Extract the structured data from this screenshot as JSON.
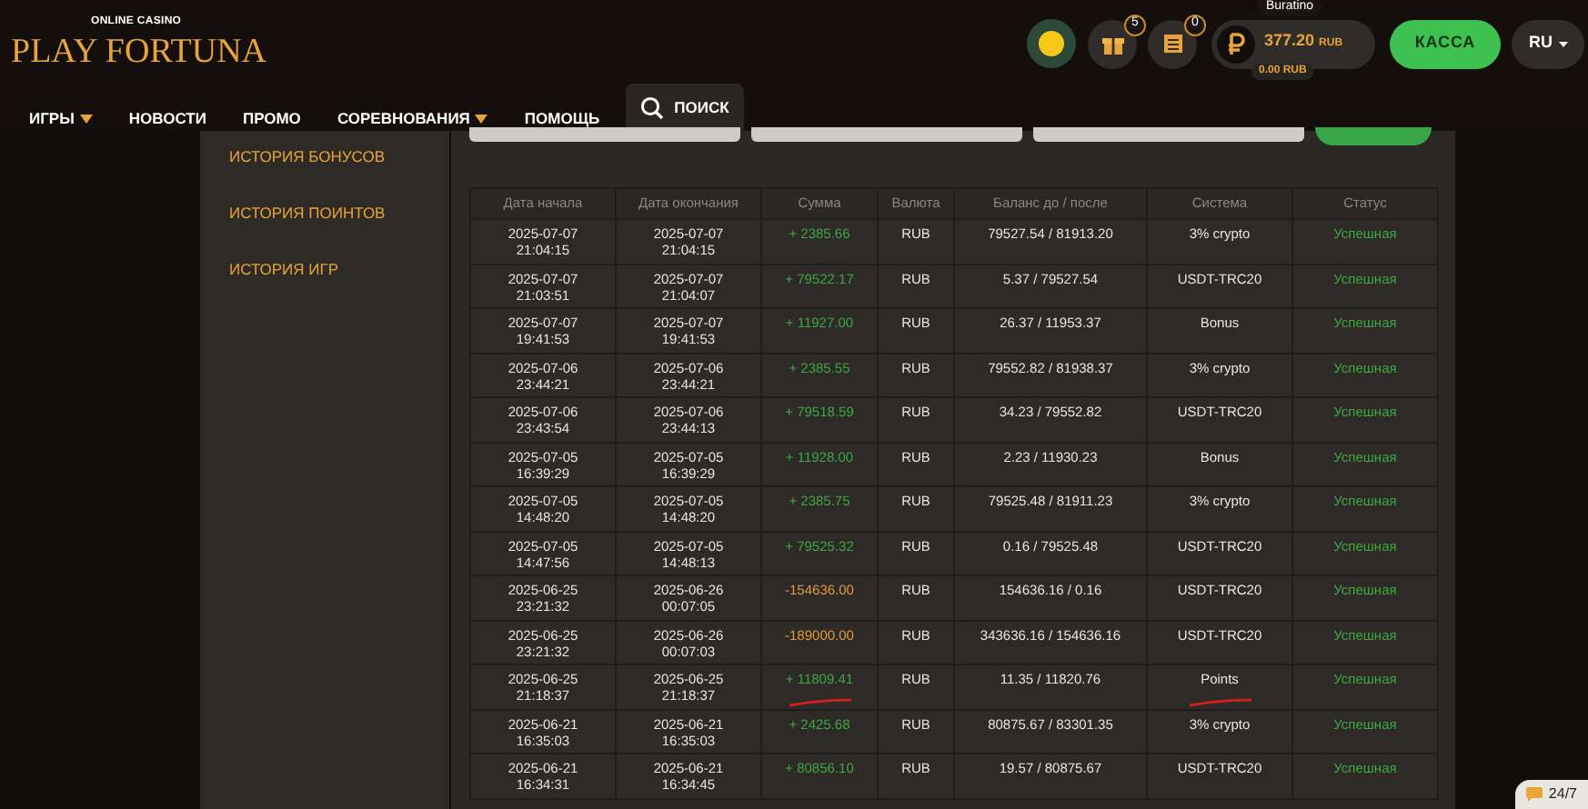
{
  "logo": {
    "tagline": "ONLINE CASINO",
    "name": "PLAY FORTUNA"
  },
  "nav": [
    {
      "label": "ИГРЫ",
      "dropdown": true
    },
    {
      "label": "НОВОСТИ",
      "dropdown": false
    },
    {
      "label": "ПРОМО",
      "dropdown": false
    },
    {
      "label": "СОРЕВНОВАНИЯ",
      "dropdown": true
    },
    {
      "label": "ПОМОЩЬ",
      "dropdown": false
    }
  ],
  "search": {
    "label": "ПОИСК"
  },
  "account": {
    "gifts_count": "5",
    "tasks_count": "0",
    "username": "Buratino",
    "balance": "377.20",
    "currency": "RUB",
    "bonus_balance": "0.00 RUB"
  },
  "cashier_button": "КАССА",
  "language": "RU",
  "sidebar": {
    "items": [
      {
        "label": "ИСТОРИЯ БОНУСОВ"
      },
      {
        "label": "ИСТОРИЯ ПОИНТОВ"
      },
      {
        "label": "ИСТОРИЯ ИГР"
      }
    ]
  },
  "table": {
    "columns": [
      "Дата начала",
      "Дата окончания",
      "Сумма",
      "Валюта",
      "Баланс до / после",
      "Система",
      "Статус"
    ],
    "rows": [
      {
        "start": [
          "2025-07-07",
          "21:04:15"
        ],
        "end": [
          "2025-07-07",
          "21:04:15"
        ],
        "sum": "+ 2385.66",
        "kind": "credit",
        "currency": "RUB",
        "balance": "79527.54 / 81913.20",
        "system": "3% crypto",
        "status": "Успешная",
        "underlined": false
      },
      {
        "start": [
          "2025-07-07",
          "21:03:51"
        ],
        "end": [
          "2025-07-07",
          "21:04:07"
        ],
        "sum": "+ 79522.17",
        "kind": "credit",
        "currency": "RUB",
        "balance": "5.37 / 79527.54",
        "system": "USDT-TRC20",
        "status": "Успешная",
        "underlined": false
      },
      {
        "start": [
          "2025-07-07",
          "19:41:53"
        ],
        "end": [
          "2025-07-07",
          "19:41:53"
        ],
        "sum": "+ 11927.00",
        "kind": "credit",
        "currency": "RUB",
        "balance": "26.37 / 11953.37",
        "system": "Bonus",
        "status": "Успешная",
        "underlined": false
      },
      {
        "start": [
          "2025-07-06",
          "23:44:21"
        ],
        "end": [
          "2025-07-06",
          "23:44:21"
        ],
        "sum": "+ 2385.55",
        "kind": "credit",
        "currency": "RUB",
        "balance": "79552.82 / 81938.37",
        "system": "3% crypto",
        "status": "Успешная",
        "underlined": false
      },
      {
        "start": [
          "2025-07-06",
          "23:43:54"
        ],
        "end": [
          "2025-07-06",
          "23:44:13"
        ],
        "sum": "+ 79518.59",
        "kind": "credit",
        "currency": "RUB",
        "balance": "34.23 / 79552.82",
        "system": "USDT-TRC20",
        "status": "Успешная",
        "underlined": false
      },
      {
        "start": [
          "2025-07-05",
          "16:39:29"
        ],
        "end": [
          "2025-07-05",
          "16:39:29"
        ],
        "sum": "+ 11928.00",
        "kind": "credit",
        "currency": "RUB",
        "balance": "2.23 / 11930.23",
        "system": "Bonus",
        "status": "Успешная",
        "underlined": false
      },
      {
        "start": [
          "2025-07-05",
          "14:48:20"
        ],
        "end": [
          "2025-07-05",
          "14:48:20"
        ],
        "sum": "+ 2385.75",
        "kind": "credit",
        "currency": "RUB",
        "balance": "79525.48 / 81911.23",
        "system": "3% crypto",
        "status": "Успешная",
        "underlined": false
      },
      {
        "start": [
          "2025-07-05",
          "14:47:56"
        ],
        "end": [
          "2025-07-05",
          "14:48:13"
        ],
        "sum": "+ 79525.32",
        "kind": "credit",
        "currency": "RUB",
        "balance": "0.16 / 79525.48",
        "system": "USDT-TRC20",
        "status": "Успешная",
        "underlined": false
      },
      {
        "start": [
          "2025-06-25",
          "23:21:32"
        ],
        "end": [
          "2025-06-26",
          "00:07:05"
        ],
        "sum": "-154636.00",
        "kind": "debit",
        "currency": "RUB",
        "balance": "154636.16 / 0.16",
        "system": "USDT-TRC20",
        "status": "Успешная",
        "underlined": false
      },
      {
        "start": [
          "2025-06-25",
          "23:21:32"
        ],
        "end": [
          "2025-06-26",
          "00:07:03"
        ],
        "sum": "-189000.00",
        "kind": "debit",
        "currency": "RUB",
        "balance": "343636.16 / 154636.16",
        "system": "USDT-TRC20",
        "status": "Успешная",
        "underlined": false
      },
      {
        "start": [
          "2025-06-25",
          "21:18:37"
        ],
        "end": [
          "2025-06-25",
          "21:18:37"
        ],
        "sum": "+ 11809.41",
        "kind": "credit",
        "currency": "RUB",
        "balance": "11.35 / 11820.76",
        "system": "Points",
        "status": "Успешная",
        "underlined": true
      },
      {
        "start": [
          "2025-06-21",
          "16:35:03"
        ],
        "end": [
          "2025-06-21",
          "16:35:03"
        ],
        "sum": "+ 2425.68",
        "kind": "credit",
        "currency": "RUB",
        "balance": "80875.67 / 83301.35",
        "system": "3% crypto",
        "status": "Успешная",
        "underlined": false
      },
      {
        "start": [
          "2025-06-21",
          "16:34:31"
        ],
        "end": [
          "2025-06-21",
          "16:34:45"
        ],
        "sum": "+ 80856.10",
        "kind": "credit",
        "currency": "RUB",
        "balance": "19.57 / 80875.67",
        "system": "USDT-TRC20",
        "status": "Успешная",
        "underlined": false
      }
    ]
  },
  "support_badge": "24/7"
}
